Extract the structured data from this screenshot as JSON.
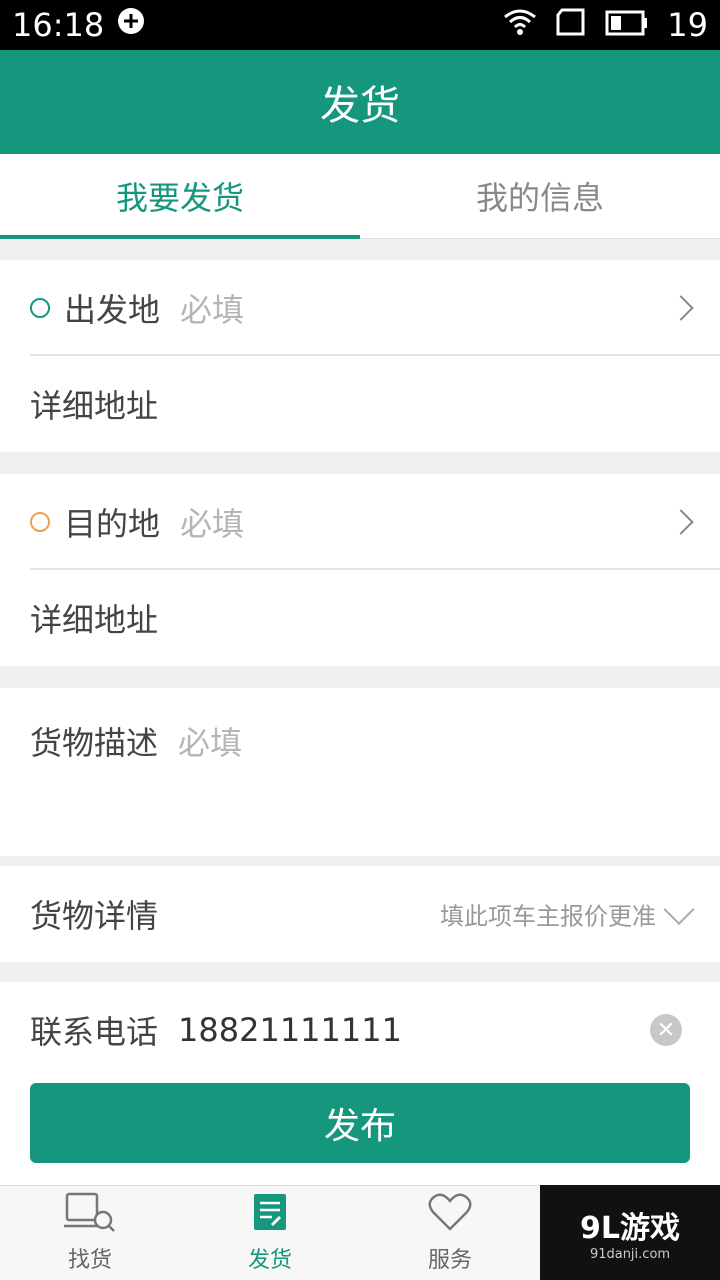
{
  "status_bar": {
    "time": "16:18",
    "battery": "19"
  },
  "header": {
    "title": "发货"
  },
  "tabs": [
    {
      "label": "我要发货",
      "active": true
    },
    {
      "label": "我的信息",
      "active": false
    }
  ],
  "origin": {
    "label": "出发地",
    "placeholder": "必填",
    "detail_label": "详细地址"
  },
  "destination": {
    "label": "目的地",
    "placeholder": "必填",
    "detail_label": "详细地址"
  },
  "cargo_description": {
    "label": "货物描述",
    "placeholder": "必填"
  },
  "cargo_details": {
    "label": "货物详情",
    "hint": "填此项车主报价更准"
  },
  "contact": {
    "label": "联系电话",
    "value": "18821111111"
  },
  "publish_button": {
    "label": "发布"
  },
  "bottom_nav": [
    {
      "label": "找货",
      "icon": "search-goods-icon",
      "active": false
    },
    {
      "label": "发货",
      "icon": "publish-doc-icon",
      "active": true
    },
    {
      "label": "服务",
      "icon": "heart-icon",
      "active": false
    }
  ],
  "watermark": {
    "main": "9L游戏",
    "sub": "91danji.com"
  },
  "colors": {
    "accent": "#15977e",
    "origin_dot": "#15977e",
    "dest_dot": "#f0a050"
  }
}
